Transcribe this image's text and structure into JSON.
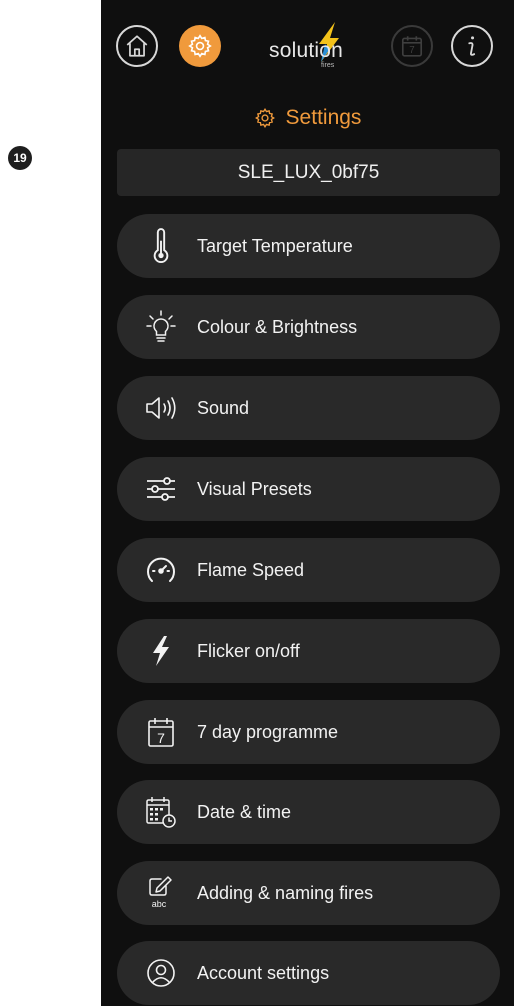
{
  "annotation": {
    "step_number": "19"
  },
  "header": {
    "logo_text": "solution",
    "logo_subtext": "fires",
    "home_icon": "home-icon",
    "settings_icon": "gear-icon",
    "calendar_icon": "calendar-icon",
    "calendar_day": "7",
    "info_icon": "info-icon",
    "accent_color": "#f09a3c"
  },
  "page": {
    "title": "Settings"
  },
  "device": {
    "name": "SLE_LUX_0bf75"
  },
  "menu": {
    "items": [
      {
        "label": "Target Temperature",
        "icon": "thermometer-icon"
      },
      {
        "label": "Colour & Brightness",
        "icon": "lightbulb-icon"
      },
      {
        "label": "Sound",
        "icon": "speaker-icon"
      },
      {
        "label": "Visual Presets",
        "icon": "sliders-icon"
      },
      {
        "label": "Flame Speed",
        "icon": "speedometer-icon"
      },
      {
        "label": "Flicker on/off",
        "icon": "lightning-icon"
      },
      {
        "label": "7 day programme",
        "icon": "calendar-seven-icon",
        "icon_text": "7"
      },
      {
        "label": "Date & time",
        "icon": "calendar-clock-icon"
      },
      {
        "label": "Adding & naming fires",
        "icon": "edit-abc-icon",
        "icon_text": "abc"
      },
      {
        "label": "Account settings",
        "icon": "user-circle-icon"
      }
    ]
  }
}
